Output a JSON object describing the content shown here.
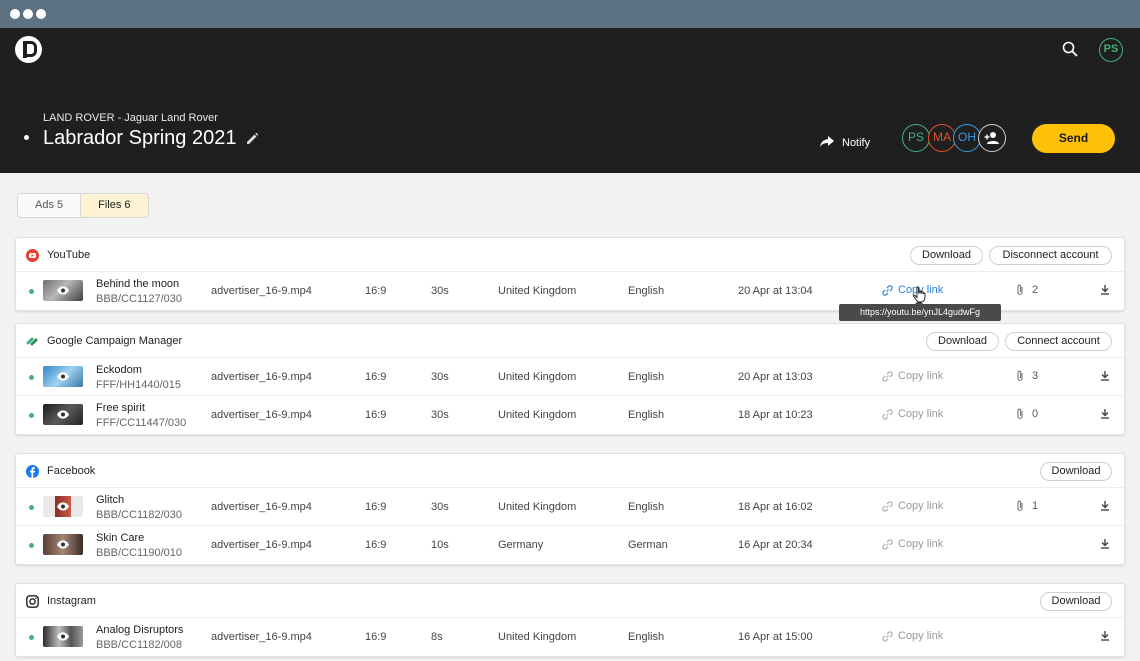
{
  "header": {
    "client": "LAND ROVER - Jaguar Land Rover",
    "campaign_title": "Labrador Spring 2021",
    "notify_label": "Notify",
    "send_label": "Send",
    "current_user_initials": "PS",
    "team": [
      "PS",
      "MA",
      "OH"
    ]
  },
  "tabs": [
    {
      "label": "Ads 5",
      "active": false
    },
    {
      "label": "Files 6",
      "active": true
    }
  ],
  "tooltip": "https://youtu.be/ynJL4gudwFg",
  "platforms": [
    {
      "name": "YouTube",
      "actions": [
        "Download",
        "Disconnect account"
      ],
      "rows": [
        {
          "name": "Behind the moon",
          "code": "BBB/CC1127/030",
          "file": "advertiser_16-9.mp4",
          "ratio": "16:9",
          "duration": "30s",
          "country": "United Kingdom",
          "language": "English",
          "date": "20 Apr at 13:04",
          "copy": "Copy link",
          "attachments": "2"
        }
      ]
    },
    {
      "name": "Google Campaign Manager",
      "actions": [
        "Download",
        "Connect account"
      ],
      "rows": [
        {
          "name": "Eckodom",
          "code": "FFF/HH1440/015",
          "file": "advertiser_16-9.mp4",
          "ratio": "16:9",
          "duration": "30s",
          "country": "United Kingdom",
          "language": "English",
          "date": "20 Apr at 13:03",
          "copy": "Copy link",
          "attachments": "3"
        },
        {
          "name": "Free spirit",
          "code": "FFF/CC11447/030",
          "file": "advertiser_16-9.mp4",
          "ratio": "16:9",
          "duration": "30s",
          "country": "United Kingdom",
          "language": "English",
          "date": "18 Apr at 10:23",
          "copy": "Copy link",
          "attachments": "0"
        }
      ]
    },
    {
      "name": "Facebook",
      "actions": [
        "Download"
      ],
      "rows": [
        {
          "name": "Glitch",
          "code": "BBB/CC1182/030",
          "file": "advertiser_16-9.mp4",
          "ratio": "16:9",
          "duration": "30s",
          "country": "United Kingdom",
          "language": "English",
          "date": "18 Apr at 16:02",
          "copy": "Copy link",
          "attachments": "1"
        },
        {
          "name": "Skin Care",
          "code": "BBB/CC1190/010",
          "file": "advertiser_16-9.mp4",
          "ratio": "16:9",
          "duration": "10s",
          "country": "Germany",
          "language": "German",
          "date": "16 Apr at 20:34",
          "copy": "Copy link",
          "attachments": ""
        }
      ]
    },
    {
      "name": "Instagram",
      "actions": [
        "Download"
      ],
      "rows": [
        {
          "name": "Analog Disruptors",
          "code": "BBB/CC1182/008",
          "file": "advertiser_16-9.mp4",
          "ratio": "16:9",
          "duration": "8s",
          "country": "United Kingdom",
          "language": "English",
          "date": "16 Apr at 15:00",
          "copy": "Copy link",
          "attachments": ""
        }
      ]
    }
  ],
  "icons": {
    "search": "search-icon",
    "edit": "pencil-icon",
    "notify": "share-arrow-icon",
    "add_user": "add-user-icon",
    "view": "eye-icon",
    "link": "link-icon",
    "attachment": "paperclip-icon",
    "download": "download-icon"
  },
  "colors": {
    "accent": "#ffc107",
    "header_bg": "#1f1f1f",
    "link_active": "#2a7bd4",
    "status_live": "#45b07c"
  }
}
